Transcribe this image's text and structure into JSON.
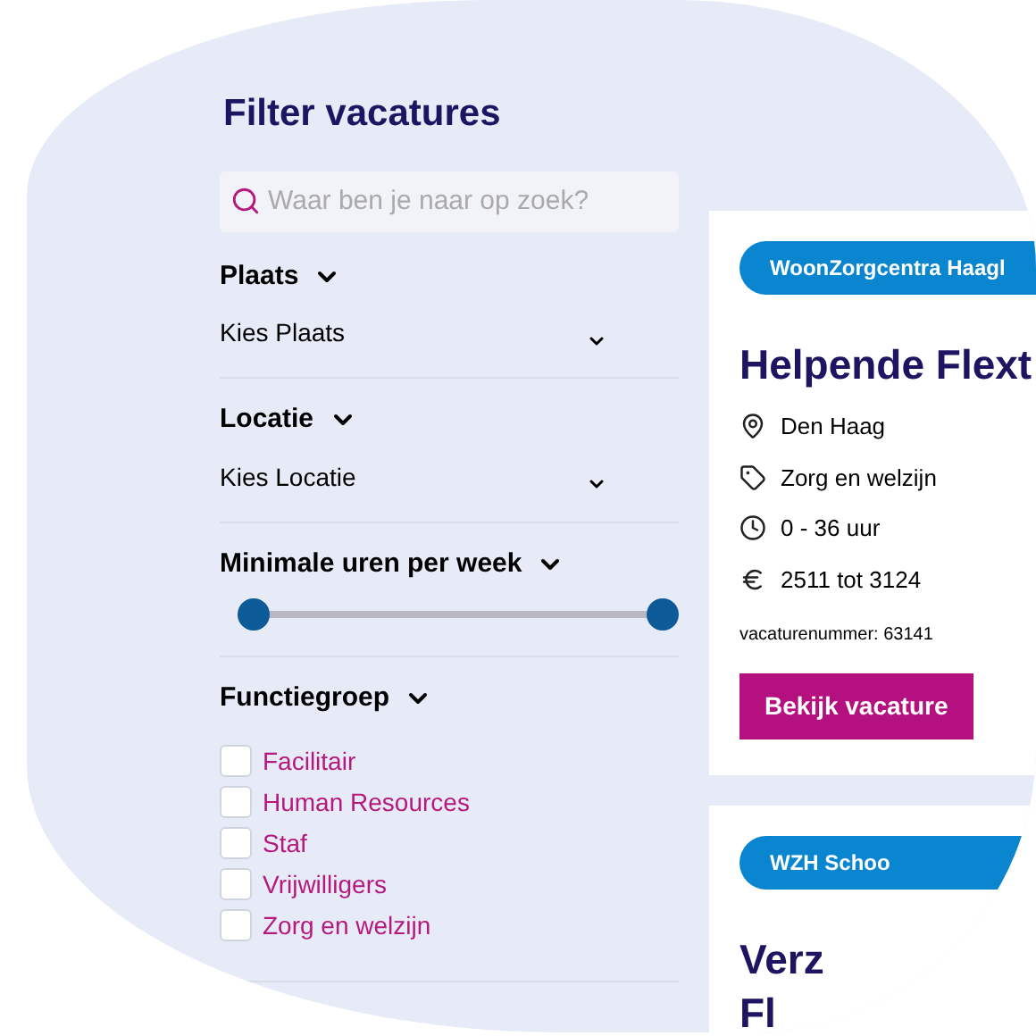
{
  "filter": {
    "title": "Filter vacatures",
    "search": {
      "placeholder": "Waar ben je naar op zoek?"
    },
    "sections": [
      {
        "kind": "select",
        "heading": "Plaats",
        "value": "Kies Plaats"
      },
      {
        "kind": "select",
        "heading": "Locatie",
        "value": "Kies Locatie"
      },
      {
        "kind": "range",
        "heading": "Minimale uren per week",
        "thumbs": [
          {
            "level": 0
          },
          {
            "level": 1
          }
        ]
      },
      {
        "kind": "checklist",
        "heading": "Functiegroep",
        "options": [
          {
            "label": "Facilitair",
            "checked": false
          },
          {
            "label": "Human Resources",
            "checked": false
          },
          {
            "label": "Staf",
            "checked": false
          },
          {
            "label": "Vrijwilligers",
            "checked": false
          },
          {
            "label": "Zorg en welzijn",
            "checked": false
          }
        ]
      }
    ]
  },
  "vacancies": [
    {
      "organisation": "WoonZorgcentra Haagl",
      "title_lines": [
        "Helpende Flext"
      ],
      "details": [
        {
          "kind": "place",
          "text": "Den Haag"
        },
        {
          "kind": "tag",
          "text": "Zorg en welzijn"
        },
        {
          "kind": "hours",
          "text": "0 - 36 uur"
        },
        {
          "kind": "salary",
          "text": "2511 tot 3124"
        }
      ],
      "number": "vacaturenummer: 63141",
      "button": "Bekijk vacature"
    },
    {
      "organisation": "WZH Schoo",
      "title_lines": [
        "Verz",
        "Fl"
      ]
    }
  ]
}
